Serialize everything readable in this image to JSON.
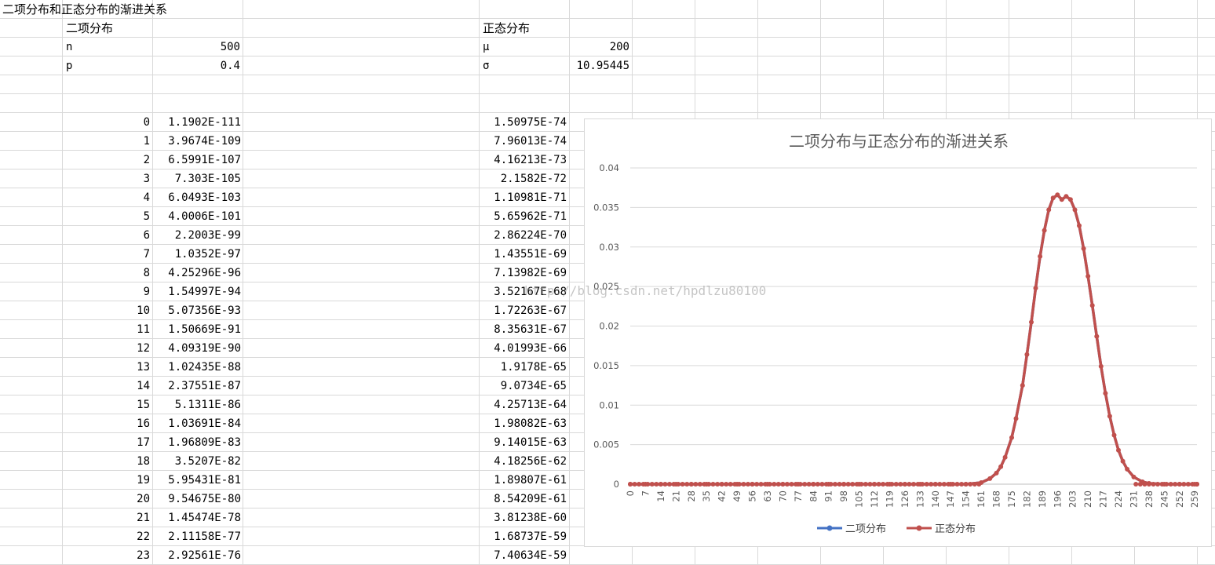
{
  "sheet": {
    "title": "二项分布和正态分布的渐进关系",
    "binomial": {
      "header": "二项分布",
      "n_label": "n",
      "n_value": "500",
      "p_label": "p",
      "p_value": "0.4"
    },
    "normal": {
      "header": "正态分布",
      "mu_label": "μ",
      "mu_value": "200",
      "sigma_label": "σ",
      "sigma_value": "10.95445"
    },
    "rows": [
      {
        "k": "0",
        "binom": "1.1902E-111",
        "normal": "1.50975E-74"
      },
      {
        "k": "1",
        "binom": "3.9674E-109",
        "normal": "7.96013E-74"
      },
      {
        "k": "2",
        "binom": "6.5991E-107",
        "normal": "4.16213E-73"
      },
      {
        "k": "3",
        "binom": "7.303E-105",
        "normal": "2.1582E-72"
      },
      {
        "k": "4",
        "binom": "6.0493E-103",
        "normal": "1.10981E-71"
      },
      {
        "k": "5",
        "binom": "4.0006E-101",
        "normal": "5.65962E-71"
      },
      {
        "k": "6",
        "binom": "2.2003E-99",
        "normal": "2.86224E-70"
      },
      {
        "k": "7",
        "binom": "1.0352E-97",
        "normal": "1.43551E-69"
      },
      {
        "k": "8",
        "binom": "4.25296E-96",
        "normal": "7.13982E-69"
      },
      {
        "k": "9",
        "binom": "1.54997E-94",
        "normal": "3.52167E-68"
      },
      {
        "k": "10",
        "binom": "5.07356E-93",
        "normal": "1.72263E-67"
      },
      {
        "k": "11",
        "binom": "1.50669E-91",
        "normal": "8.35631E-67"
      },
      {
        "k": "12",
        "binom": "4.09319E-90",
        "normal": "4.01993E-66"
      },
      {
        "k": "13",
        "binom": "1.02435E-88",
        "normal": "1.9178E-65"
      },
      {
        "k": "14",
        "binom": "2.37551E-87",
        "normal": "9.0734E-65"
      },
      {
        "k": "15",
        "binom": "5.1311E-86",
        "normal": "4.25713E-64"
      },
      {
        "k": "16",
        "binom": "1.03691E-84",
        "normal": "1.98082E-63"
      },
      {
        "k": "17",
        "binom": "1.96809E-83",
        "normal": "9.14015E-63"
      },
      {
        "k": "18",
        "binom": "3.5207E-82",
        "normal": "4.18256E-62"
      },
      {
        "k": "19",
        "binom": "5.95431E-81",
        "normal": "1.89807E-61"
      },
      {
        "k": "20",
        "binom": "9.54675E-80",
        "normal": "8.54209E-61"
      },
      {
        "k": "21",
        "binom": "1.45474E-78",
        "normal": "3.81238E-60"
      },
      {
        "k": "22",
        "binom": "2.11158E-77",
        "normal": "1.68737E-59"
      },
      {
        "k": "23",
        "binom": "2.92561E-76",
        "normal": "7.40634E-59"
      }
    ]
  },
  "watermark": "http://blog.csdn.net/hpdlzu80100",
  "chart_data": {
    "type": "line",
    "title": "二项分布与正态分布的渐进关系",
    "xlabel": "",
    "ylabel": "",
    "x_range": [
      0,
      260
    ],
    "x_tick_labels": [
      "0",
      "7",
      "14",
      "21",
      "28",
      "35",
      "42",
      "49",
      "56",
      "63",
      "70",
      "77",
      "84",
      "91",
      "98",
      "105",
      "112",
      "119",
      "126",
      "133",
      "140",
      "147",
      "154",
      "161",
      "168",
      "175",
      "182",
      "189",
      "196",
      "203",
      "210",
      "217",
      "224",
      "231",
      "238",
      "245",
      "252",
      "259"
    ],
    "ylim": [
      0,
      0.04
    ],
    "y_tick_labels": [
      "0",
      "0.005",
      "0.01",
      "0.015",
      "0.02",
      "0.025",
      "0.03",
      "0.035",
      "0.04"
    ],
    "grid": true,
    "legend_position": "bottom",
    "series": [
      {
        "name": "二项分布",
        "color": "#4472c4",
        "distribution": "binomial",
        "n": 500,
        "p": 0.4
      },
      {
        "name": "正态分布",
        "color": "#c0504d",
        "distribution": "normal",
        "mu": 200,
        "sigma": 10.95445
      }
    ],
    "x": [
      0,
      7,
      14,
      21,
      28,
      35,
      42,
      49,
      56,
      63,
      70,
      77,
      84,
      91,
      98,
      105,
      112,
      119,
      126,
      133,
      140,
      147,
      154,
      161,
      165,
      168,
      170,
      172,
      175,
      177,
      180,
      182,
      184,
      186,
      188,
      190,
      192,
      194,
      196,
      198,
      200,
      202,
      204,
      206,
      208,
      210,
      212,
      214,
      216,
      218,
      220,
      222,
      224,
      226,
      228,
      231,
      235,
      238,
      245,
      252,
      259,
      260
    ],
    "values_binomial": [
      0,
      0,
      0,
      0,
      0,
      0,
      0,
      0,
      0,
      0,
      0,
      0,
      0,
      0,
      0,
      0,
      0,
      0,
      0,
      0,
      0,
      0,
      0,
      0.0002,
      0.0007,
      0.0014,
      0.0022,
      0.0034,
      0.0059,
      0.0083,
      0.0125,
      0.0164,
      0.0205,
      0.0248,
      0.0288,
      0.0321,
      0.0347,
      0.0362,
      0.0366,
      0.036,
      0.0364,
      0.036,
      0.0347,
      0.0327,
      0.0298,
      0.0263,
      0.0226,
      0.0187,
      0.0149,
      0.0115,
      0.0086,
      0.0062,
      0.0043,
      0.0029,
      0.0019,
      0.0009,
      0.0003,
      0.0001,
      0,
      0,
      0,
      0
    ],
    "values_normal": [
      0,
      0,
      0,
      0,
      0,
      0,
      0,
      0,
      0,
      0,
      0,
      0,
      0,
      0,
      0,
      0,
      0,
      0,
      0,
      0,
      0,
      0,
      0,
      0.0002,
      0.0007,
      0.0014,
      0.0022,
      0.0034,
      0.0059,
      0.0083,
      0.0125,
      0.0164,
      0.0205,
      0.0248,
      0.0288,
      0.0321,
      0.0347,
      0.0362,
      0.0366,
      0.036,
      0.0364,
      0.036,
      0.0347,
      0.0327,
      0.0298,
      0.0263,
      0.0226,
      0.0187,
      0.0149,
      0.0115,
      0.0086,
      0.0062,
      0.0043,
      0.0029,
      0.0019,
      0.0009,
      0.0003,
      0.0001,
      0,
      0,
      0,
      0
    ]
  }
}
